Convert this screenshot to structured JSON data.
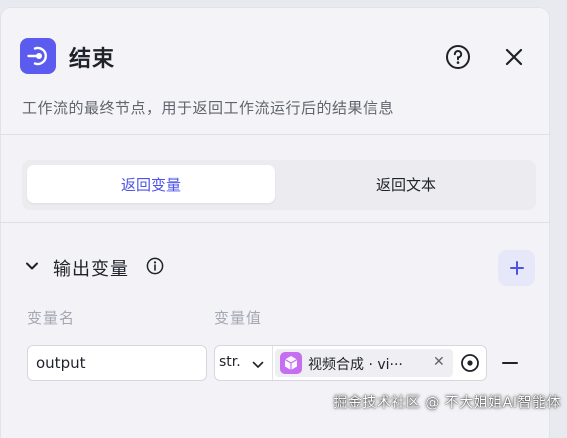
{
  "node": {
    "title": "结束",
    "description": "工作流的最终节点，用于返回工作流运行后的结果信息",
    "icon": "end-node-icon",
    "accent_color": "#5b5bf0"
  },
  "header_actions": {
    "help_icon": "question-circle-icon",
    "close_icon": "close-icon"
  },
  "tabs": [
    {
      "label": "返回变量",
      "active": true
    },
    {
      "label": "返回文本",
      "active": false
    }
  ],
  "output_section": {
    "title": "输出变量",
    "info_icon": "info-circle-icon",
    "add_icon": "plus-icon",
    "columns": {
      "name": "变量名",
      "value": "变量值"
    },
    "rows": [
      {
        "name": "output",
        "type": "str.",
        "reference": "视频合成 · vi···",
        "reference_icon_color": "#c56ff0"
      }
    ]
  },
  "watermark": "掘金技术社区 @ 不大姐姐AI智能体"
}
